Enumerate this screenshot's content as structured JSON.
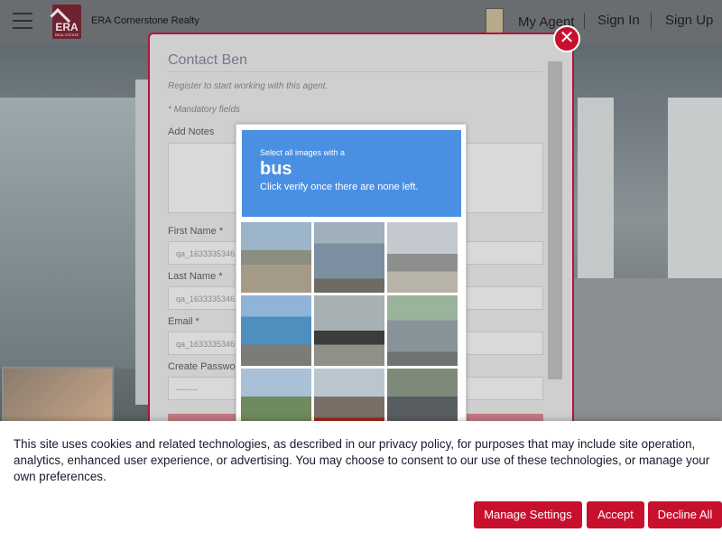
{
  "header": {
    "brand_logo_text": "ERA",
    "brand_logo_subtext": "REAL ESTATE",
    "brand_name": "ERA Cornerstone Realty",
    "nav": {
      "my_agent": "My Agent",
      "sign_in": "Sign In",
      "sign_up": "Sign Up"
    }
  },
  "modal": {
    "title": "Contact Ben",
    "subtitle": "Register to start working with this agent.",
    "mandatory_note": "* Mandatory fields",
    "fields": {
      "notes_label": "Add Notes",
      "first_name_label": "First Name *",
      "first_name_value": "qa_1633335346",
      "last_name_label": "Last Name *",
      "last_name_value": "qa_1633335346",
      "email_label": "Email *",
      "email_value": "qa_1633335346",
      "password_label": "Create Password",
      "password_value": "--------"
    },
    "close_symbol": "✕"
  },
  "captcha": {
    "instruction_small": "Select all images with a",
    "target": "bus",
    "instruction_hint": "Click verify once there are none left.",
    "tiles": [
      "road",
      "bus",
      "highway",
      "bus",
      "traffic-light",
      "car",
      "palm-tree",
      "bus",
      "car"
    ]
  },
  "cookie_banner": {
    "text": "This site uses cookies and related technologies, as described in our privacy policy, for purposes that may include site operation, analytics, enhanced user experience, or advertising. You may choose to consent to our use of these technologies, or manage your own preferences.",
    "manage_label": "Manage Settings",
    "accept_label": "Accept",
    "decline_label": "Decline All"
  },
  "colors": {
    "brand_red": "#c8102e",
    "captcha_blue": "#4a90e2"
  }
}
